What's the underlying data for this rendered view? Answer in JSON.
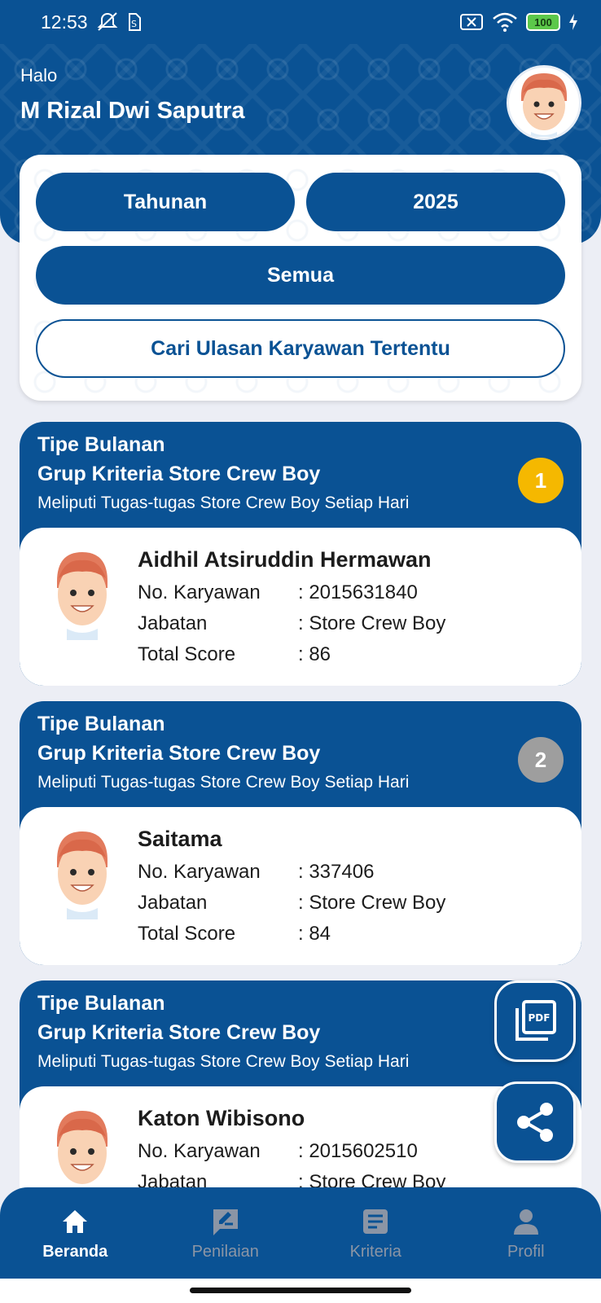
{
  "status_bar": {
    "time": "12:53",
    "left_icons": [
      "mute-icon",
      "sim-icon"
    ],
    "right_icons": [
      "no-sim-icon",
      "wifi-icon"
    ],
    "battery": "100"
  },
  "header": {
    "greeting": "Halo",
    "user_name": "M Rizal Dwi Saputra"
  },
  "filters": {
    "period": "Tahunan",
    "year": "2025",
    "group": "Semua",
    "search_button": "Cari Ulasan Karyawan Tertentu"
  },
  "labels": {
    "employee_no": "No. Karyawan",
    "position": "Jabatan",
    "total_score": "Total Score"
  },
  "reviews": [
    {
      "type": "Tipe Bulanan",
      "group": "Grup Kriteria Store Crew Boy",
      "description": "Meliputi Tugas-tugas Store Crew Boy Setiap Hari",
      "rank": "1",
      "rank_color": "#f5b800",
      "name": "Aidhil Atsiruddin Hermawan",
      "employee_no": ": 2015631840",
      "position": ": Store Crew Boy",
      "total_score": ": 86"
    },
    {
      "type": "Tipe Bulanan",
      "group": "Grup Kriteria Store Crew Boy",
      "description": "Meliputi Tugas-tugas Store Crew Boy Setiap Hari",
      "rank": "2",
      "rank_color": "#9e9e9e",
      "name": "Saitama",
      "employee_no": ": 337406",
      "position": ": Store Crew Boy",
      "total_score": ": 84"
    },
    {
      "type": "Tipe Bulanan",
      "group": "Grup Kriteria Store Crew Boy",
      "description": "Meliputi Tugas-tugas Store Crew Boy Setiap Hari",
      "name": "Katon Wibisono",
      "employee_no": ": 2015602510",
      "position": ": Store Crew Boy"
    }
  ],
  "fabs": {
    "pdf_icon": "pdf-icon",
    "share_icon": "share-icon"
  },
  "bottom_nav": [
    {
      "label": "Beranda",
      "icon": "home-icon",
      "active": true
    },
    {
      "label": "Penilaian",
      "icon": "rate-icon",
      "active": false
    },
    {
      "label": "Kriteria",
      "icon": "document-icon",
      "active": false
    },
    {
      "label": "Profil",
      "icon": "person-icon",
      "active": false
    }
  ],
  "colors": {
    "primary": "#0a5294",
    "background": "#eceef5",
    "gold": "#f5b800",
    "silver": "#9e9e9e",
    "nav_inactive": "#8b95a5"
  }
}
